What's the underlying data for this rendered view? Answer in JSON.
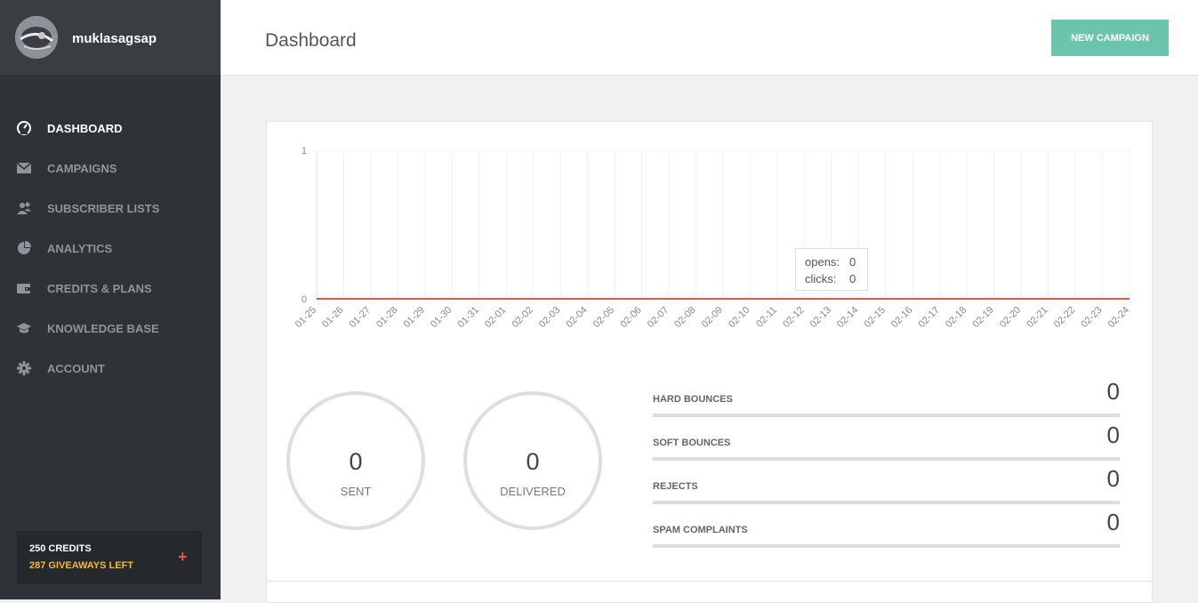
{
  "user": {
    "name": "muklasagsap"
  },
  "sidebar": {
    "items": [
      {
        "label": "DASHBOARD",
        "icon": "speedometer-icon",
        "active": true
      },
      {
        "label": "CAMPAIGNS",
        "icon": "envelope-icon"
      },
      {
        "label": "SUBSCRIBER LISTS",
        "icon": "users-icon"
      },
      {
        "label": "ANALYTICS",
        "icon": "pie-chart-icon"
      },
      {
        "label": "CREDITS & PLANS",
        "icon": "wallet-icon"
      },
      {
        "label": "KNOWLEDGE BASE",
        "icon": "graduation-cap-icon"
      },
      {
        "label": "ACCOUNT",
        "icon": "gear-icon"
      }
    ],
    "credits": {
      "credits_label": "250 CREDITS",
      "giveaways_label": "287 GIVEAWAYS LEFT",
      "add": "+"
    }
  },
  "header": {
    "title": "Dashboard",
    "new_campaign": "NEW CAMPAIGN"
  },
  "chart_data": {
    "type": "line",
    "x": [
      "01-25",
      "01-26",
      "01-27",
      "01-28",
      "01-29",
      "01-30",
      "01-31",
      "02-01",
      "02-02",
      "02-03",
      "02-04",
      "02-05",
      "02-06",
      "02-07",
      "02-08",
      "02-09",
      "02-10",
      "02-11",
      "02-12",
      "02-13",
      "02-14",
      "02-15",
      "02-16",
      "02-17",
      "02-18",
      "02-19",
      "02-20",
      "02-21",
      "02-22",
      "02-23",
      "02-24"
    ],
    "series": [
      {
        "name": "opens",
        "values": [
          0,
          0,
          0,
          0,
          0,
          0,
          0,
          0,
          0,
          0,
          0,
          0,
          0,
          0,
          0,
          0,
          0,
          0,
          0,
          0,
          0,
          0,
          0,
          0,
          0,
          0,
          0,
          0,
          0,
          0,
          0
        ],
        "color": "#e05b47"
      },
      {
        "name": "clicks",
        "values": [
          0,
          0,
          0,
          0,
          0,
          0,
          0,
          0,
          0,
          0,
          0,
          0,
          0,
          0,
          0,
          0,
          0,
          0,
          0,
          0,
          0,
          0,
          0,
          0,
          0,
          0,
          0,
          0,
          0,
          0,
          0
        ]
      }
    ],
    "yticks": [
      "1",
      "0"
    ],
    "ylim": [
      0,
      1
    ],
    "grid": true,
    "tooltip": {
      "opens_label": "opens:",
      "opens_value": "0",
      "clicks_label": "clicks:",
      "clicks_value": "0"
    }
  },
  "summary": {
    "sent": {
      "value": "0",
      "label": "SENT"
    },
    "delivered": {
      "value": "0",
      "label": "DELIVERED"
    }
  },
  "stats": [
    {
      "label": "HARD BOUNCES",
      "value": "0"
    },
    {
      "label": "SOFT BOUNCES",
      "value": "0"
    },
    {
      "label": "REJECTS",
      "value": "0"
    },
    {
      "label": "SPAM COMPLAINTS",
      "value": "0"
    }
  ],
  "colors": {
    "accent": "#6cc4ad",
    "line": "#e05b47",
    "sidebar": "#2f3237",
    "credits_highlight": "#f0b93a"
  }
}
